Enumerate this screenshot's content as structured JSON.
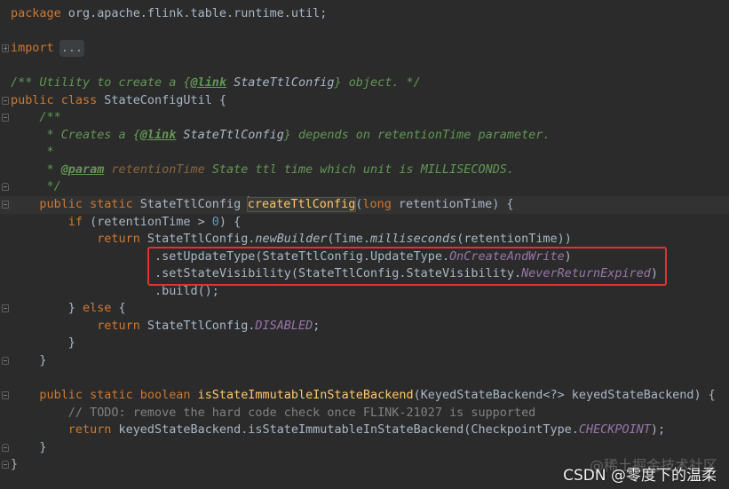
{
  "syntax_colors": {
    "background": "#2b2b2b",
    "active_line": "#323232",
    "kw": "#cc7832",
    "plain": "#a9b7c6",
    "decl": "#ffc66d",
    "call": "#a9b7c6",
    "const": "#9876aa",
    "num": "#6897bb",
    "doc": "#629755",
    "tag": "#629755",
    "ref": "#a9b7c6",
    "param": "#8a653b",
    "comment": "#808080",
    "fold": "#9a9a9a"
  },
  "editor": {
    "lines": [
      {
        "tokens": [
          {
            "kw": "package"
          },
          {
            "plain": " org.apache.flink.table.runtime.util;"
          }
        ]
      },
      {
        "tokens": []
      },
      {
        "tokens": [
          {
            "kw": "import"
          },
          {
            "plain": " "
          },
          {
            "fold": "..."
          }
        ],
        "gutter_icon": "fold-expand-icon"
      },
      {
        "tokens": []
      },
      {
        "tokens": [
          {
            "doc": "/** Utility to create a {"
          },
          {
            "tag": "@link"
          },
          {
            "ref": " StateTtlConfig"
          },
          {
            "doc": "} object. */"
          }
        ]
      },
      {
        "tokens": [
          {
            "kw": "public class"
          },
          {
            "plain": " StateConfigUtil {"
          }
        ],
        "gutter_icon": "fold-collapse-icon"
      },
      {
        "tokens": [
          {
            "doc": "    /**"
          }
        ],
        "gutter_icon": "fold-collapse-icon"
      },
      {
        "tokens": [
          {
            "doc": "     * Creates a {"
          },
          {
            "tag": "@link"
          },
          {
            "ref": " StateTtlConfig"
          },
          {
            "doc": "} depends on retentionTime parameter."
          }
        ]
      },
      {
        "tokens": [
          {
            "doc": "     *"
          }
        ]
      },
      {
        "tokens": [
          {
            "doc": "     * "
          },
          {
            "tag": "@param"
          },
          {
            "doc": " "
          },
          {
            "param": "retentionTime"
          },
          {
            "doc": " State ttl time which unit is MILLISECONDS."
          }
        ]
      },
      {
        "tokens": [
          {
            "doc": "     */"
          }
        ],
        "gutter_icon": "fold-end-icon"
      },
      {
        "tokens": [
          {
            "plain": "    "
          },
          {
            "kw": "public static"
          },
          {
            "plain": " StateTtlConfig "
          },
          {
            "decl": "createTtlConfig"
          },
          {
            "plain": "("
          },
          {
            "kw": "long"
          },
          {
            "plain": " retentionTime) {"
          }
        ],
        "gutter_icon": "fold-collapse-icon",
        "active": true,
        "caret_token": 3
      },
      {
        "tokens": [
          {
            "plain": "        "
          },
          {
            "kw": "if"
          },
          {
            "plain": " (retentionTime > "
          },
          {
            "num": "0"
          },
          {
            "plain": ") {"
          }
        ]
      },
      {
        "tokens": [
          {
            "plain": "            "
          },
          {
            "kw": "return"
          },
          {
            "plain": " StateTtlConfig."
          },
          {
            "call": "newBuilder"
          },
          {
            "plain": "(Time."
          },
          {
            "call": "milliseconds"
          },
          {
            "plain": "(retentionTime))"
          }
        ]
      },
      {
        "tokens": [
          {
            "plain": "                    .setUpdateType(StateTtlConfig.UpdateType."
          },
          {
            "const": "OnCreateAndWrite"
          },
          {
            "plain": ")"
          }
        ]
      },
      {
        "tokens": [
          {
            "plain": "                    .setStateVisibility(StateTtlConfig.StateVisibility."
          },
          {
            "const": "NeverReturnExpired"
          },
          {
            "plain": ")"
          }
        ]
      },
      {
        "tokens": [
          {
            "plain": "                    .build();"
          }
        ]
      },
      {
        "tokens": [
          {
            "plain": "        } "
          },
          {
            "kw": "else"
          },
          {
            "plain": " {"
          }
        ],
        "gutter_icon": "fold-collapse-icon"
      },
      {
        "tokens": [
          {
            "plain": "            "
          },
          {
            "kw": "return"
          },
          {
            "plain": " StateTtlConfig."
          },
          {
            "const": "DISABLED"
          },
          {
            "plain": ";"
          }
        ]
      },
      {
        "tokens": [
          {
            "plain": "        }"
          }
        ]
      },
      {
        "tokens": [
          {
            "plain": "    }"
          }
        ],
        "gutter_icon": "fold-end-icon"
      },
      {
        "tokens": []
      },
      {
        "tokens": [
          {
            "plain": "    "
          },
          {
            "kw": "public static boolean"
          },
          {
            "plain": " "
          },
          {
            "decl": "isStateImmutableInStateBackend"
          },
          {
            "plain": "(KeyedStateBackend<?> keyedStateBackend) {"
          }
        ],
        "gutter_icon": "fold-collapse-icon"
      },
      {
        "tokens": [
          {
            "plain": "        "
          },
          {
            "comment": "// TODO: remove the hard code check once FLINK-21027 is supported"
          }
        ]
      },
      {
        "tokens": [
          {
            "plain": "        "
          },
          {
            "kw": "return"
          },
          {
            "plain": " keyedStateBackend.isStateImmutableInStateBackend(CheckpointType."
          },
          {
            "const": "CHECKPOINT"
          },
          {
            "plain": ");"
          }
        ]
      },
      {
        "tokens": [
          {
            "plain": "    }"
          }
        ],
        "gutter_icon": "fold-end-icon"
      },
      {
        "tokens": [
          {
            "plain": "}"
          }
        ],
        "gutter_icon": "fold-end-icon"
      }
    ],
    "annotation_box": {
      "first_line": 15,
      "last_line": 16,
      "color": "#e0342f"
    }
  },
  "watermark": {
    "juejin": "@稀土掘金技术社区",
    "csdn": "CSDN @零度下的温柔"
  }
}
